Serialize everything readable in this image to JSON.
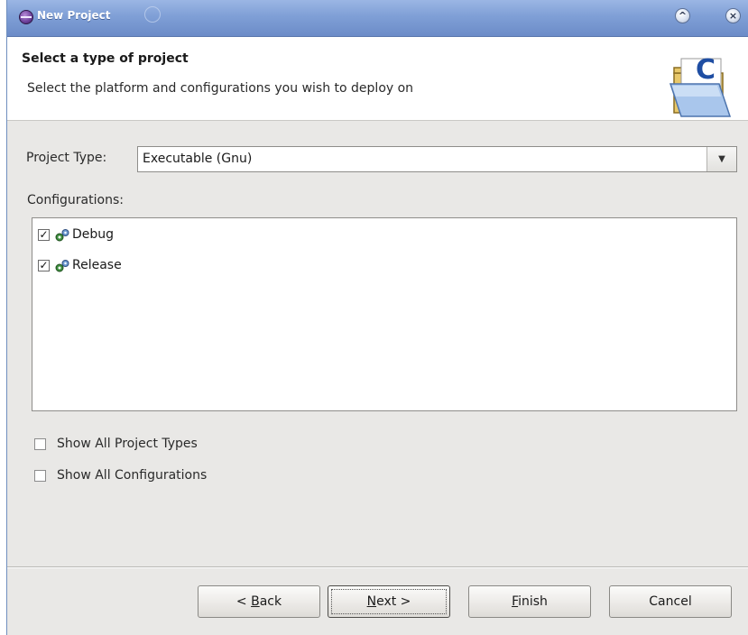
{
  "window": {
    "title": "New Project"
  },
  "header": {
    "title": "Select a type of project",
    "description": "Select the platform and configurations you wish to deploy on"
  },
  "project_type": {
    "label": "Project Type:",
    "selected": "Executable (Gnu)"
  },
  "configurations": {
    "label": "Configurations:",
    "items": [
      {
        "label": "Debug",
        "checked": true
      },
      {
        "label": "Release",
        "checked": true
      }
    ]
  },
  "options": {
    "show_all_project_types": {
      "label": "Show All Project Types",
      "checked": false
    },
    "show_all_configurations": {
      "label": "Show All Configurations",
      "checked": false
    }
  },
  "buttons": {
    "back": {
      "prefix": "< ",
      "mnemonic": "B",
      "rest": "ack"
    },
    "next": {
      "mnemonic": "N",
      "rest": "ext >"
    },
    "finish": {
      "mnemonic": "F",
      "rest": "inish"
    },
    "cancel": "Cancel"
  },
  "icons": {
    "app": "eclipse-icon",
    "shade": "shade-icon",
    "maximize": "chevron-up-icon",
    "close": "close-icon",
    "wizard": "c-project-folder-icon",
    "configuration": "gears-icon",
    "dropdown": "chevron-down-icon"
  },
  "colors": {
    "titlebar": "#7f9fd6",
    "dialog_bg": "#e9e8e6"
  }
}
